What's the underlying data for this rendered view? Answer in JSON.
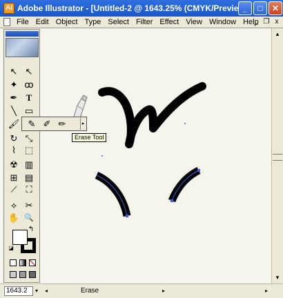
{
  "window": {
    "title": "Adobe Illustrator - [Untitled-2 @ 1643.25% (CMYK/Previe...",
    "minimize": "_",
    "maximize": "□",
    "close": "✕",
    "app_icon_letter": "Ai"
  },
  "menubar": {
    "items": [
      "File",
      "Edit",
      "Object",
      "Type",
      "Select",
      "Filter",
      "Effect",
      "View",
      "Window",
      "Help"
    ],
    "doc_minimize": "_",
    "doc_restore": "❐",
    "doc_close": "x"
  },
  "toolbox": {
    "tools": [
      {
        "name": "selection-tool",
        "glyph": "↖"
      },
      {
        "name": "direct-selection-tool",
        "glyph": "↖"
      },
      {
        "name": "pen-tool",
        "glyph": "✒"
      },
      {
        "name": "lasso-tool",
        "glyph": "ꝏ"
      },
      {
        "name": "magic-wand-tool",
        "glyph": "✦"
      },
      {
        "name": "type-tool",
        "glyph": "T"
      },
      {
        "name": "line-tool",
        "glyph": "╲"
      },
      {
        "name": "rectangle-tool",
        "glyph": "▭"
      },
      {
        "name": "paintbrush-tool",
        "glyph": "🖌"
      },
      {
        "name": "pencil-tool",
        "glyph": "✎"
      },
      {
        "name": "rotate-tool",
        "glyph": "↻"
      },
      {
        "name": "scale-tool",
        "glyph": "⤡"
      },
      {
        "name": "warp-tool",
        "glyph": "⌇"
      },
      {
        "name": "free-transform-tool",
        "glyph": "⬚"
      },
      {
        "name": "symbol-sprayer-tool",
        "glyph": "☢"
      },
      {
        "name": "graph-tool",
        "glyph": "▥"
      },
      {
        "name": "mesh-tool",
        "glyph": "⊞"
      },
      {
        "name": "gradient-tool",
        "glyph": "▤"
      },
      {
        "name": "eyedropper-tool",
        "glyph": "⟋"
      },
      {
        "name": "blend-tool",
        "glyph": "⛶"
      },
      {
        "name": "slice-tool",
        "glyph": "⟡"
      },
      {
        "name": "scissors-tool",
        "glyph": "✂"
      },
      {
        "name": "hand-tool",
        "glyph": "✋"
      },
      {
        "name": "zoom-tool",
        "glyph": "🔍"
      }
    ],
    "fill_color": "#ffffff",
    "stroke_color": "#000000",
    "swap_glyph": "↰",
    "default_glyph": "◪"
  },
  "flyout": {
    "tools": [
      {
        "name": "pencil-tool",
        "glyph": "✎"
      },
      {
        "name": "smooth-tool",
        "glyph": "✐"
      },
      {
        "name": "erase-tool",
        "glyph": "✏"
      }
    ],
    "tearoff": "▸",
    "tooltip": "Erase Tool"
  },
  "statusbar": {
    "zoom": "1643.2",
    "zoom_arrow": "▾",
    "status": "Erase",
    "left_arrow": "◂",
    "right_arrow": "▸"
  },
  "scroll": {
    "up": "▴",
    "down": "▾"
  },
  "colors": {
    "path_stroke": "#000000",
    "selection": "#3c5fe0",
    "canvas": "#f5f5ee"
  }
}
